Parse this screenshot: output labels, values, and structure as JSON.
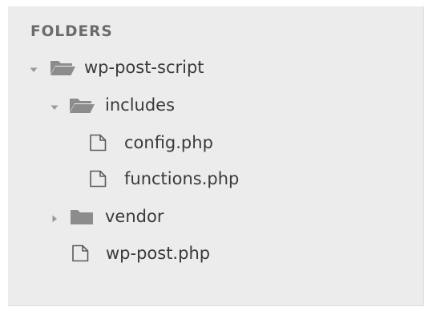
{
  "sidebar": {
    "header": "FOLDERS",
    "tree": {
      "root": {
        "label": "wp-post-script",
        "state": "expanded",
        "children": {
          "includes": {
            "label": "includes",
            "state": "expanded",
            "files": [
              "config.php",
              "functions.php"
            ]
          },
          "vendor": {
            "label": "vendor",
            "state": "collapsed"
          },
          "file": {
            "label": "wp-post.php"
          }
        }
      }
    }
  },
  "icons": {
    "expanded": "caret-down-icon",
    "collapsed": "caret-right-icon",
    "folder_open": "folder-open-icon",
    "folder_closed": "folder-icon",
    "file": "file-icon"
  },
  "colors": {
    "panel_bg": "#ececec",
    "header_text": "#6b6b6b",
    "item_text": "#3a3a3a",
    "icon": "#8c8c8c"
  }
}
